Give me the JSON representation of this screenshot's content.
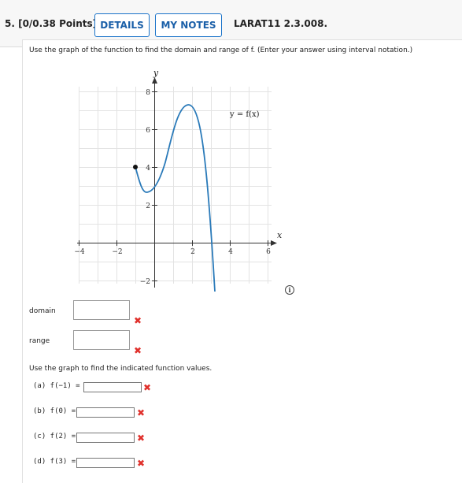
{
  "header": {
    "question_label": "5. [0/0.38 Points]",
    "details_label": "DETAILS",
    "notes_label": "MY NOTES",
    "code": "LARAT11 2.3.008."
  },
  "instructions": "Use the graph of the function to find the domain and range of f. (Enter your answer using interval notation.)",
  "graph": {
    "y_axis_label": "y",
    "x_axis_label": "x",
    "curve_label": "y = f(x)",
    "x_tick_labels": [
      "−4",
      "−2",
      "2",
      "4",
      "6"
    ],
    "y_tick_labels": [
      "8",
      "6",
      "4",
      "2",
      "−2"
    ],
    "curve_color": "#2a7ab9"
  },
  "domain_range": {
    "domain_label": "domain",
    "range_label": "range",
    "domain_value": "",
    "range_value": ""
  },
  "values_instructions": "Use the graph to find the indicated function values.",
  "parts": [
    {
      "label": "(a)  f(−1) =",
      "value": ""
    },
    {
      "label": "(b)  f(0) =",
      "value": ""
    },
    {
      "label": "(c)  f(2) =",
      "value": ""
    },
    {
      "label": "(d)  f(3) =",
      "value": ""
    }
  ],
  "status": {
    "incorrect_symbol": "✖",
    "info_symbol": "i",
    "incorrect_color": "#e0312c"
  }
}
